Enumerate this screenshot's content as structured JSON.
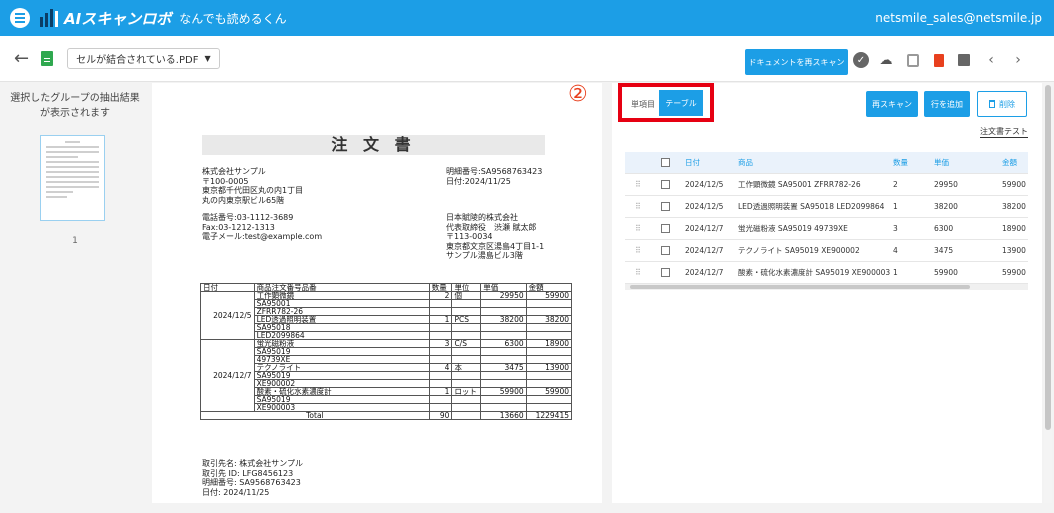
{
  "header": {
    "logo_text": "AIスキャンロボ",
    "logo_sub": "なんでも読めるくん",
    "user_email": "netsmile_sales@netsmile.jp"
  },
  "toolbar": {
    "file_name": "セルが結合されている.PDF",
    "rescan_document": "ドキュメントを再スキャン"
  },
  "thumbnails": {
    "message": "選択したグループの抽出結果が表示されます",
    "page_number": "1"
  },
  "document": {
    "title": "注 文 書",
    "left_block": [
      "株式会社サンプル",
      "〒100-0005",
      "東京都千代田区丸の内1丁目",
      "丸の内東京駅ビル65階"
    ],
    "contact_block": [
      "電話番号:03-1112-3689",
      "Fax:03-1212-1313",
      "電子メール:test@example.com"
    ],
    "right_block": [
      "明細番号:SA9568763423",
      "日付:2024/11/25"
    ],
    "company_block": [
      "日本賦陵的株式会社",
      "代表取締役　渋瀬 賦太郎",
      "〒113-0034",
      "東京都文京区湯島4丁目1-1",
      "サンプル湯島ビル3階"
    ],
    "table": {
      "headers": [
        "日付",
        "商品注文番号品番",
        "数量",
        "単位",
        "単価",
        "金額"
      ],
      "date1": "2024/12/5",
      "date2": "2024/12/7",
      "rows": [
        [
          "工作顕微鏡",
          "2",
          "個",
          "29950",
          "59900"
        ],
        [
          "SA95001",
          "",
          "",
          "",
          ""
        ],
        [
          "ZFRR782-26",
          "",
          "",
          "",
          ""
        ],
        [
          "LED透過照明装置",
          "1",
          "PCS",
          "38200",
          "38200"
        ],
        [
          "SA95018",
          "",
          "",
          "",
          ""
        ],
        [
          "LED2099864",
          "",
          "",
          "",
          ""
        ],
        [
          "蛍光磁粉液",
          "3",
          "C/S",
          "6300",
          "18900"
        ],
        [
          "SA95019",
          "",
          "",
          "",
          ""
        ],
        [
          "49739XE",
          "",
          "",
          "",
          ""
        ],
        [
          "テクノライト",
          "4",
          "本",
          "3475",
          "13900"
        ],
        [
          "SA95019",
          "",
          "",
          "",
          ""
        ],
        [
          "XE900002",
          "",
          "",
          "",
          ""
        ],
        [
          "酸素・硫化水素濃度計",
          "1",
          "ロット",
          "59900",
          "59900"
        ],
        [
          "SA95019",
          "",
          "",
          "",
          ""
        ],
        [
          "XE900003",
          "",
          "",
          "",
          ""
        ]
      ],
      "total_label": "Total",
      "total_qty": "90",
      "total_price": "13660",
      "total_amount": "1229415"
    },
    "footer": [
      "取引先名: 株式会社サンプル",
      "取引先 ID: LFG8456123",
      "明細番号: SA9568763423",
      "日付: 2024/11/25"
    ]
  },
  "panel": {
    "annotation_number": "②",
    "mode_single": "単項目",
    "mode_table": "テーブル",
    "rescan": "再スキャン",
    "add_row": "行を追加",
    "delete": "削除",
    "doc_test": "注文書テスト"
  },
  "grid": {
    "headers": [
      "日付",
      "商品",
      "数量",
      "単価",
      "金額"
    ],
    "rows": [
      [
        "2024/12/5",
        "工作顕微鏡 SA95001 ZFRR782-26",
        "2",
        "29950",
        "59900"
      ],
      [
        "2024/12/5",
        "LED透過照明装置 SA95018 LED2099864",
        "1",
        "38200",
        "38200"
      ],
      [
        "2024/12/7",
        "蛍光磁粉液 SA95019 49739XE",
        "3",
        "6300",
        "18900"
      ],
      [
        "2024/12/7",
        "テクノライト SA95019 XE900002",
        "4",
        "3475",
        "13900"
      ],
      [
        "2024/12/7",
        "酸素・硫化水素濃度計 SA95019 XE900003",
        "1",
        "59900",
        "59900"
      ]
    ]
  },
  "icons": {
    "menu": "menu-icon",
    "back": "arrow-left-icon",
    "check": "check-circle-icon",
    "cloud": "cloud-download-icon",
    "save": "save-icon",
    "trash": "trash-icon",
    "flag": "comment-icon",
    "prev": "chevron-left-icon",
    "next": "chevron-right-icon"
  },
  "colors": {
    "accent": "#1c9ee6",
    "highlight": "#e60012",
    "danger": "#e8401e"
  }
}
